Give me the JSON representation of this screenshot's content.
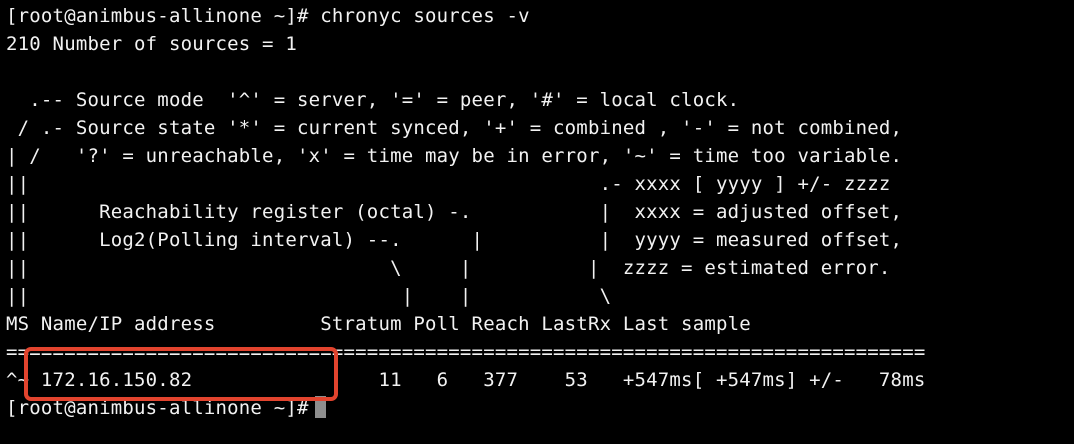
{
  "terminal": {
    "lines": [
      "[root@animbus-allinone ~]# chronyc sources -v",
      "210 Number of sources = 1",
      "",
      "  .-- Source mode  '^' = server, '=' = peer, '#' = local clock.",
      " / .- Source state '*' = current synced, '+' = combined , '-' = not combined,",
      "| /   '?' = unreachable, 'x' = time may be in error, '~' = time too variable.",
      "||                                                 .- xxxx [ yyyy ] +/- zzzz",
      "||      Reachability register (octal) -.           |  xxxx = adjusted offset,",
      "||      Log2(Polling interval) --.      |          |  yyyy = measured offset,",
      "||                               \\     |          |  zzzz = estimated error.",
      "||                                |    |           \\",
      "MS Name/IP address         Stratum Poll Reach LastRx Last sample",
      "===============================================================================",
      "^~ 172.16.150.82                11   6   377    53   +547ms[ +547ms] +/-   78ms",
      "[root@animbus-allinone ~]#"
    ]
  },
  "colors": {
    "background": "#000000",
    "text": "#f2f2f2",
    "highlight": "#e2442e",
    "cursor": "#8e8e8e"
  }
}
